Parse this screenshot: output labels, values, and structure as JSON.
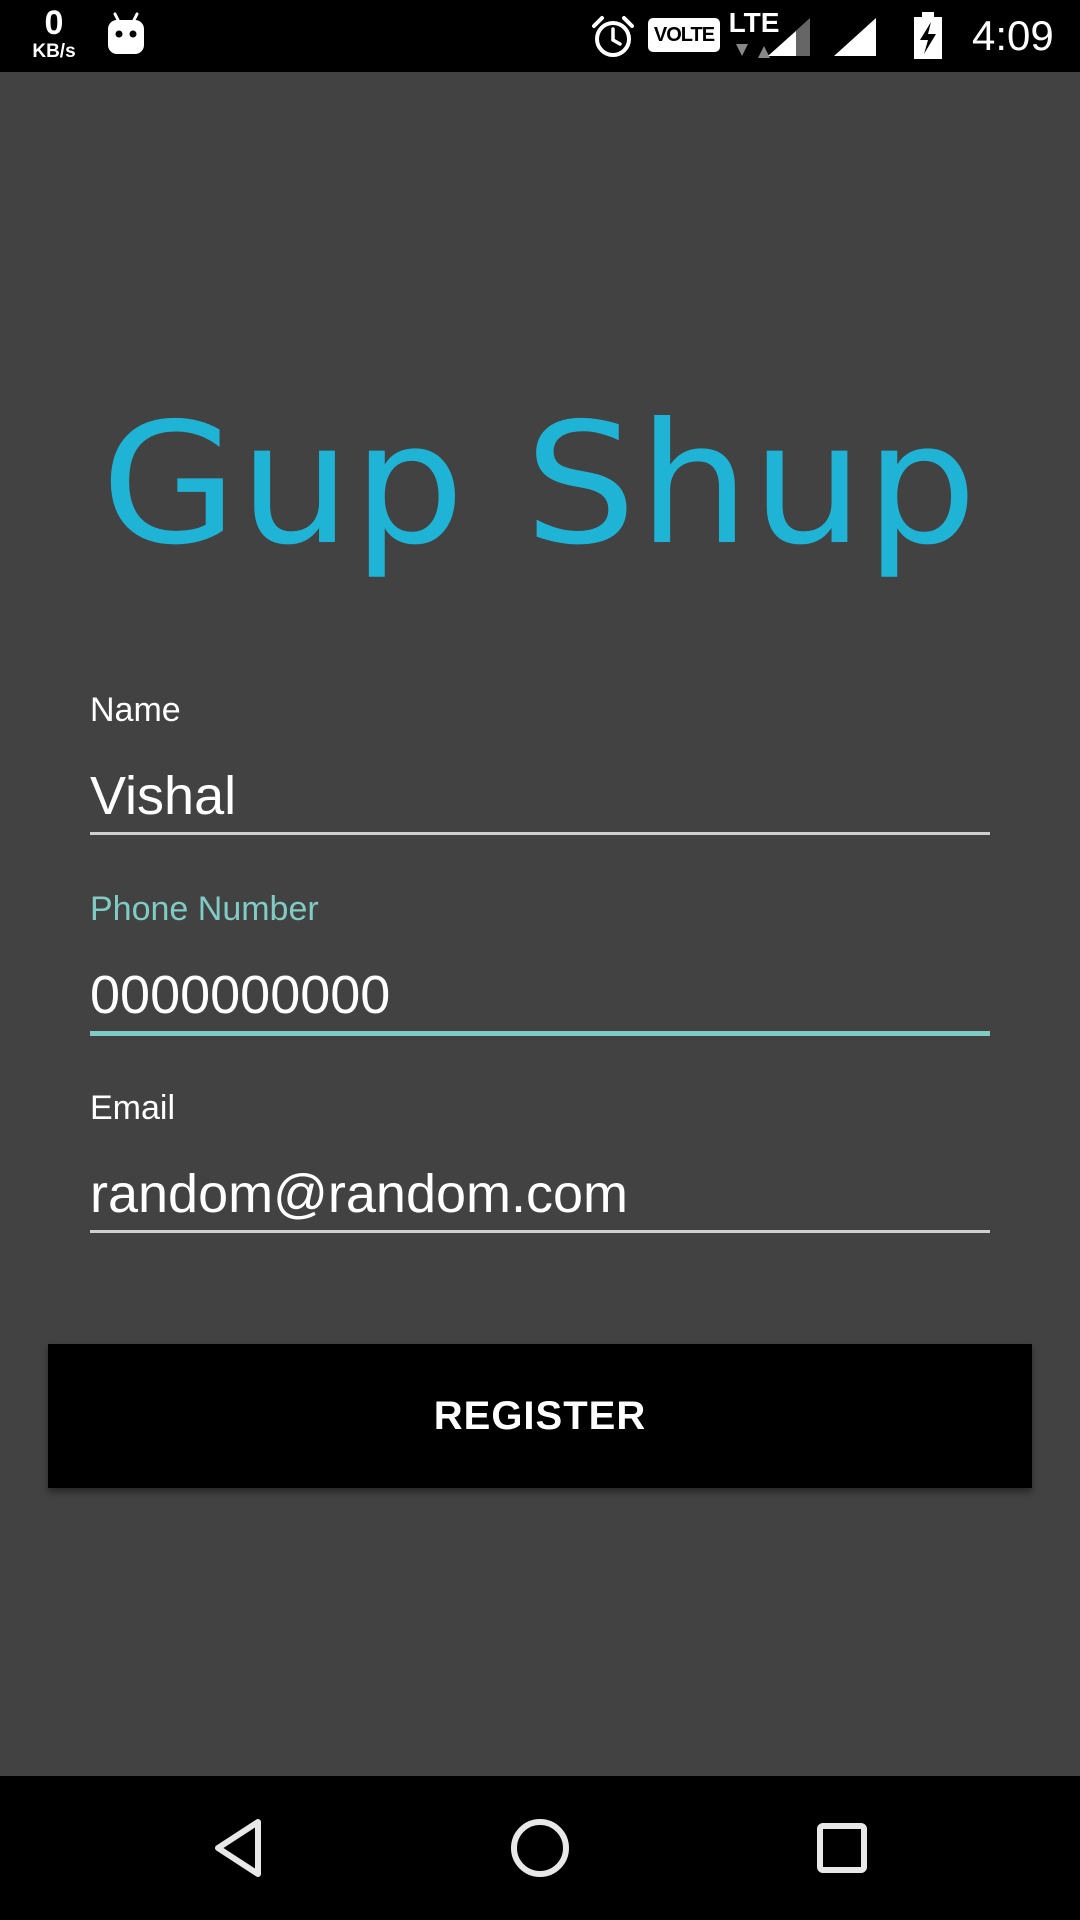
{
  "status_bar": {
    "net_speed_value": "0",
    "net_speed_unit": "KB/s",
    "volte_label": "VOLTE",
    "lte_label": "LTE",
    "time": "4:09",
    "icons": [
      "android-notification-icon",
      "alarm-icon",
      "volte-icon",
      "lte-icon",
      "signal-icon",
      "signal-icon",
      "battery-charging-icon"
    ]
  },
  "app": {
    "title": "Gup Shup",
    "accent_color": "#1fb4d6",
    "field_focus_color": "#80cbc4"
  },
  "form": {
    "name": {
      "label": "Name",
      "value": "Vishal"
    },
    "phone": {
      "label": "Phone Number",
      "value": "0000000000"
    },
    "email": {
      "label": "Email",
      "value": "random@random.com"
    },
    "register_label": "REGISTER"
  },
  "nav_bar": {
    "icons": [
      "back-icon",
      "home-icon",
      "recents-icon"
    ]
  }
}
